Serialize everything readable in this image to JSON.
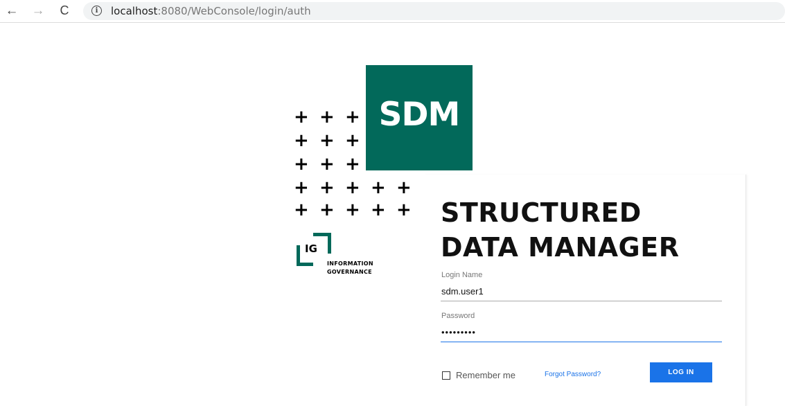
{
  "browser": {
    "back_icon": "←",
    "forward_icon": "→",
    "reload_icon": "C",
    "info_icon": "i",
    "url_host": "localhost",
    "url_rest": ":8080/WebConsole/login/auth"
  },
  "logo": {
    "sdm_text": "SDM",
    "ig_text": "IG",
    "ig_caption_line1": "INFORMATION",
    "ig_caption_line2": "GOVERNANCE",
    "brand_color": "#02695a"
  },
  "login": {
    "title_line1": "STRUCTURED",
    "title_line2": "DATA MANAGER",
    "login_name_label": "Login Name",
    "login_name_value": "sdm.user1",
    "password_label": "Password",
    "password_value": "sdmsecret",
    "remember_label": "Remember me",
    "remember_checked": false,
    "forgot_label": "Forgot Password?",
    "submit_label": "LOG IN",
    "accent_color": "#1a73e8"
  }
}
